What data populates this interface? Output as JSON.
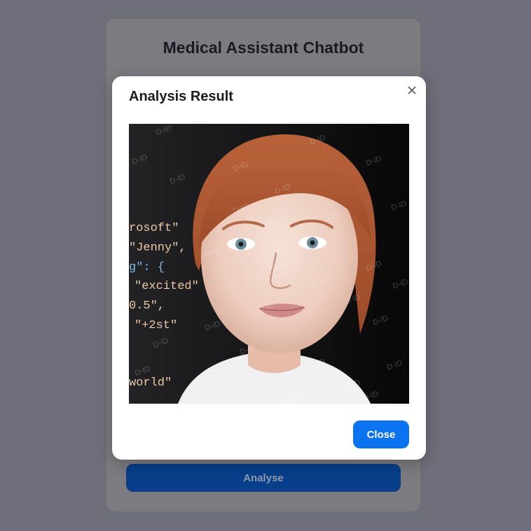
{
  "card": {
    "title": "Medical Assistant Chatbot",
    "analyse_label": "Analyse"
  },
  "modal": {
    "title": "Analysis Result",
    "close_icon": "close-icon",
    "close_label": "Close",
    "image": {
      "code_lines": [
        "rosoft\"",
        "\"Jenny\",",
        "g\": {",
        "\"excited\"",
        "0.5\",",
        "\"+2st\"",
        "world\""
      ],
      "watermark": "D-ID"
    }
  },
  "colors": {
    "backdrop": "#6f6f7b",
    "primary_button": "#0b72f0",
    "disabled_button": "#073f8a"
  }
}
